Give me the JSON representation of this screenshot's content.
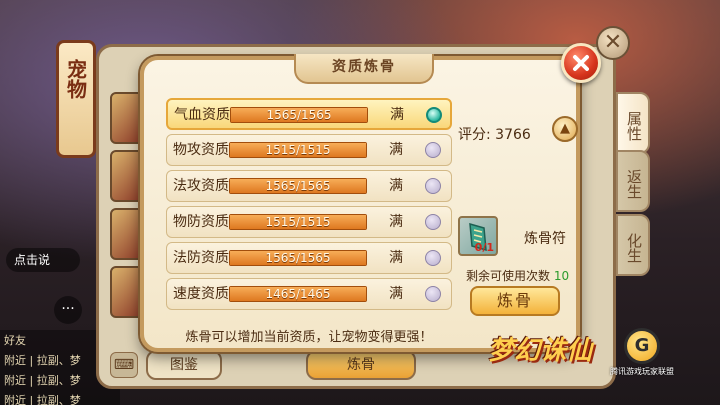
{
  "background": {
    "lantern_text": "宠物",
    "voice_label": "点击说",
    "more_label": "···",
    "chat_lines": [
      "好友",
      "附近 | 拉副、梦",
      "附近 | 拉副、梦",
      "附近 | 拉副、梦"
    ]
  },
  "back_panel": {
    "close_label": "✕",
    "tabs": [
      "属性",
      "返生",
      "化生"
    ],
    "bottom_buttons": {
      "tujian": "图鉴",
      "liangu": "炼骨"
    }
  },
  "dialog": {
    "title": "资质炼骨",
    "attributes": [
      {
        "name": "气血资质",
        "value": "1565/1565",
        "fill_percent": 100,
        "status": "满",
        "selected": true
      },
      {
        "name": "物攻资质",
        "value": "1515/1515",
        "fill_percent": 100,
        "status": "满",
        "selected": false
      },
      {
        "name": "法攻资质",
        "value": "1565/1565",
        "fill_percent": 100,
        "status": "满",
        "selected": false
      },
      {
        "name": "物防资质",
        "value": "1515/1515",
        "fill_percent": 100,
        "status": "满",
        "selected": false
      },
      {
        "name": "法防资质",
        "value": "1565/1565",
        "fill_percent": 100,
        "status": "满",
        "selected": false
      },
      {
        "name": "速度资质",
        "value": "1465/1465",
        "fill_percent": 100,
        "status": "满",
        "selected": false
      }
    ],
    "score_label": "评分",
    "score_value": "3766",
    "item": {
      "name": "炼骨符",
      "count": "0/1",
      "icon": "talisman-icon"
    },
    "remain_label": "剩余可使用次数",
    "remain_value": "10",
    "refine_button": "炼骨",
    "hint": "炼骨可以增加当前资质，让宠物变得更强！"
  },
  "branding": {
    "logo_text": "梦幻诛仙",
    "badge_text": "腾讯游戏玩家联盟"
  },
  "colors": {
    "bar": "#d66812",
    "selected_row": "#f9d77a",
    "close_red": "#d6341c",
    "remain_green": "#2c9c2d"
  }
}
